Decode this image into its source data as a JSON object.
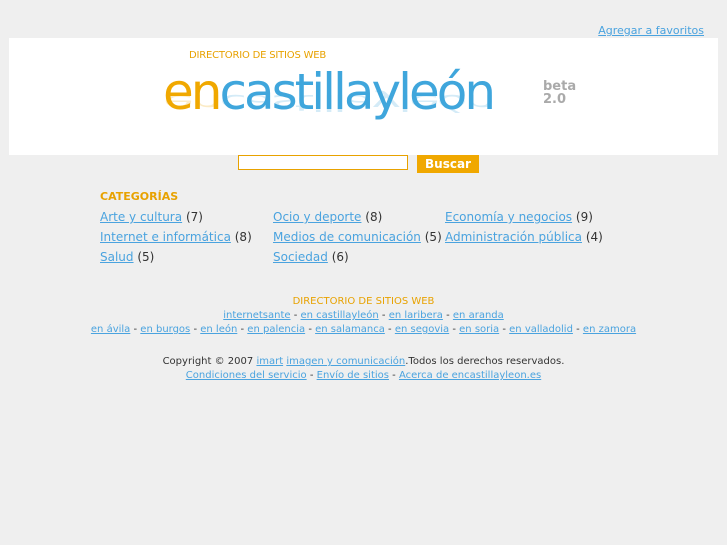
{
  "header": {
    "favorites_link": "Agregar a favoritos"
  },
  "logo": {
    "subtitle": "DIRECTORIO DE SITIOS WEB",
    "part_en": "en",
    "part_rest": "castillayleón",
    "beta": "beta",
    "version": "2.0"
  },
  "search": {
    "value": "",
    "button": "Buscar"
  },
  "categories": {
    "title": "CATEGORÍAS",
    "items": [
      {
        "label": "Arte y cultura",
        "count": "(7)"
      },
      {
        "label": "Ocio y deporte",
        "count": "(8)"
      },
      {
        "label": "Economía y negocios",
        "count": "(9)"
      },
      {
        "label": "Internet e informática",
        "count": "(8)"
      },
      {
        "label": "Medios de comunicación",
        "count": "(5)"
      },
      {
        "label": "Administración pública",
        "count": "(4)"
      },
      {
        "label": "Salud",
        "count": "(5)"
      },
      {
        "label": "Sociedad",
        "count": "(6)"
      }
    ]
  },
  "footer": {
    "directory_label": "DIRECTORIO DE SITIOS WEB",
    "network_links": [
      "internetsante",
      "en castillayleón",
      "en laribera",
      "en aranda"
    ],
    "city_links": [
      "en ávila",
      "en burgos",
      "en león",
      "en palencia",
      "en salamanca",
      "en segovia",
      "en soria",
      "en valladolid",
      "en zamora"
    ],
    "separator": "-",
    "copyright_prefix": "Copyright © 2007 ",
    "imart": "imart",
    "imart_desc": "imagen y comunicación",
    "copyright_suffix": ".Todos los derechos reservados.",
    "terms": [
      "Condiciones del servicio",
      "Envío de sitios",
      "Acerca de encastillayleon.es"
    ]
  }
}
